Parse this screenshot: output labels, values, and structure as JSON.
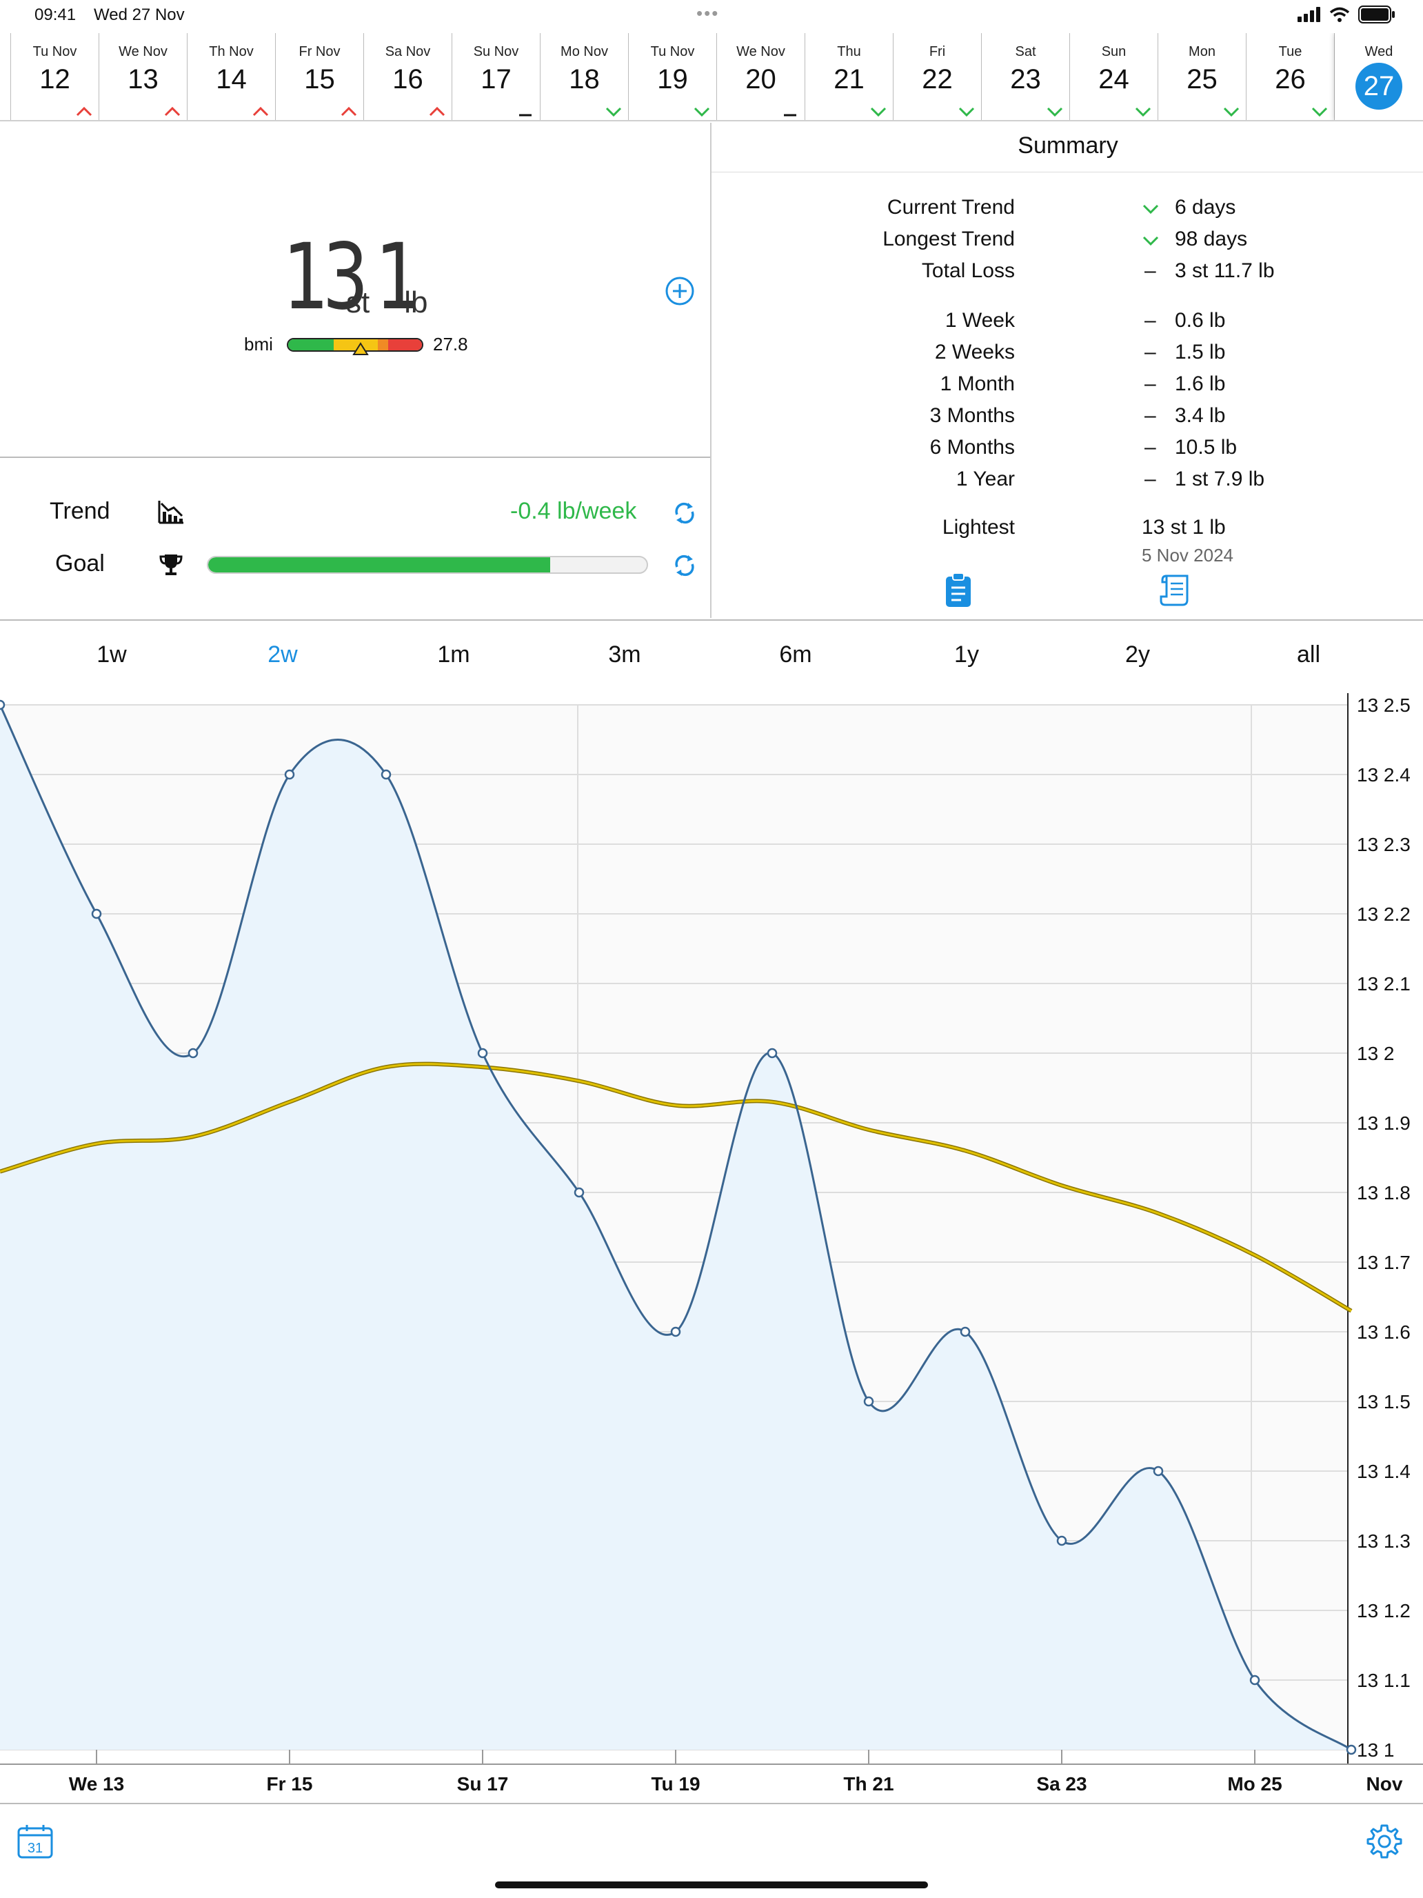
{
  "status": {
    "time": "09:41",
    "date": "Wed 27 Nov",
    "dots": "•••"
  },
  "days": [
    {
      "label": "Tu Nov",
      "num": "12",
      "trend": "up"
    },
    {
      "label": "We Nov",
      "num": "13",
      "trend": "up"
    },
    {
      "label": "Th Nov",
      "num": "14",
      "trend": "up"
    },
    {
      "label": "Fr Nov",
      "num": "15",
      "trend": "up"
    },
    {
      "label": "Sa Nov",
      "num": "16",
      "trend": "up"
    },
    {
      "label": "Su Nov",
      "num": "17",
      "trend": "flat"
    },
    {
      "label": "Mo Nov",
      "num": "18",
      "trend": "down"
    },
    {
      "label": "Tu Nov",
      "num": "19",
      "trend": "down"
    },
    {
      "label": "We Nov",
      "num": "20",
      "trend": "flat"
    },
    {
      "label": "Thu",
      "num": "21",
      "trend": "down"
    },
    {
      "label": "Fri",
      "num": "22",
      "trend": "down"
    },
    {
      "label": "Sat",
      "num": "23",
      "trend": "down"
    },
    {
      "label": "Sun",
      "num": "24",
      "trend": "down"
    },
    {
      "label": "Mon",
      "num": "25",
      "trend": "down"
    },
    {
      "label": "Tue",
      "num": "26",
      "trend": "down"
    },
    {
      "label": "Wed",
      "num": "27",
      "trend": "selected"
    }
  ],
  "weight": {
    "stone": "13",
    "st_unit": "st",
    "lb": "1",
    "lb_unit": "lb",
    "bmi_label": "bmi",
    "bmi_value": "27.8",
    "bmi_marker": 0.54
  },
  "trend": {
    "label": "Trend",
    "value": "-0.4 lb/week"
  },
  "goal": {
    "label": "Goal",
    "progress": 0.78
  },
  "summary": {
    "title": "Summary",
    "rows1": [
      {
        "label": "Current Trend",
        "sym": "down",
        "value": "6 days"
      },
      {
        "label": "Longest Trend",
        "sym": "down",
        "value": "98 days"
      },
      {
        "label": "Total Loss",
        "sym": "–",
        "value": "3 st 11.7 lb"
      }
    ],
    "rows2": [
      {
        "label": "1 Week",
        "sym": "–",
        "value": "0.6 lb"
      },
      {
        "label": "2 Weeks",
        "sym": "–",
        "value": "1.5 lb"
      },
      {
        "label": "1 Month",
        "sym": "–",
        "value": "1.6 lb"
      },
      {
        "label": "3 Months",
        "sym": "–",
        "value": "3.4 lb"
      },
      {
        "label": "6 Months",
        "sym": "–",
        "value": "10.5 lb"
      },
      {
        "label": "1 Year",
        "sym": "–",
        "value": "1 st 7.9 lb"
      }
    ],
    "lightest_label": "Lightest",
    "lightest_value": "13 st 1 lb",
    "lightest_date": "5 Nov 2024"
  },
  "periods": {
    "items": [
      "1w",
      "2w",
      "1m",
      "3m",
      "6m",
      "1y",
      "2y",
      "all"
    ],
    "active": "2w"
  },
  "colors": {
    "accent": "#1a8fe0",
    "up": "#e8403a",
    "down": "#2fb84a",
    "weight_line": "#3a6590",
    "trend_line": "#e2c200",
    "fill": "#eaf4fc"
  },
  "chart_data": {
    "type": "line",
    "y_unit": "st lb (stone + pounds)",
    "ylim": [
      13.1,
      13.25
    ],
    "y_ticks": [
      "13 1",
      "13 1.1",
      "13 1.2",
      "13 1.3",
      "13 1.4",
      "13 1.5",
      "13 1.6",
      "13 1.7",
      "13 1.8",
      "13 1.9",
      "13 2",
      "13 2.1",
      "13 2.2",
      "13 2.3",
      "13 2.4",
      "13 2.5"
    ],
    "x_ticks": [
      "We 13",
      "Fr 15",
      "Su 17",
      "Tu 19",
      "Th 21",
      "Sa 23",
      "Mo 25",
      "Nov"
    ],
    "series": [
      {
        "values_lb": [
          {
            "x": "2024-11-12",
            "y": 2.5
          },
          {
            "x": "2024-11-13",
            "y": 2.2
          },
          {
            "x": "2024-11-14",
            "y": 2.0
          },
          {
            "x": "2024-11-15",
            "y": 2.4
          },
          {
            "x": "2024-11-16",
            "y": 2.4
          },
          {
            "x": "2024-11-17",
            "y": 2.0
          },
          {
            "x": "2024-11-18",
            "y": 1.8
          },
          {
            "x": "2024-11-19",
            "y": 1.6
          },
          {
            "x": "2024-11-20",
            "y": 2.0
          },
          {
            "x": "2024-11-21",
            "y": 1.5
          },
          {
            "x": "2024-11-22",
            "y": 1.6
          },
          {
            "x": "2024-11-23",
            "y": 1.3
          },
          {
            "x": "2024-11-24",
            "y": 1.4
          },
          {
            "x": "2024-11-25",
            "y": 1.1
          },
          {
            "x": "2024-11-26",
            "y": 1.0
          }
        ]
      },
      {
        "values_lb": [
          {
            "x": "2024-11-12",
            "y": 1.83
          },
          {
            "x": "2024-11-13",
            "y": 1.87
          },
          {
            "x": "2024-11-14",
            "y": 1.88
          },
          {
            "x": "2024-11-15",
            "y": 1.93
          },
          {
            "x": "2024-11-16",
            "y": 1.98
          },
          {
            "x": "2024-11-17",
            "y": 1.98
          },
          {
            "x": "2024-11-18",
            "y": 1.96
          },
          {
            "x": "2024-11-19",
            "y": 1.925
          },
          {
            "x": "2024-11-20",
            "y": 1.93
          },
          {
            "x": "2024-11-21",
            "y": 1.89
          },
          {
            "x": "2024-11-22",
            "y": 1.86
          },
          {
            "x": "2024-11-23",
            "y": 1.81
          },
          {
            "x": "2024-11-24",
            "y": 1.77
          },
          {
            "x": "2024-11-25",
            "y": 1.71
          },
          {
            "x": "2024-11-26",
            "y": 1.63
          }
        ]
      }
    ],
    "grid": true
  },
  "bottom": {
    "calendar_day": "31"
  }
}
